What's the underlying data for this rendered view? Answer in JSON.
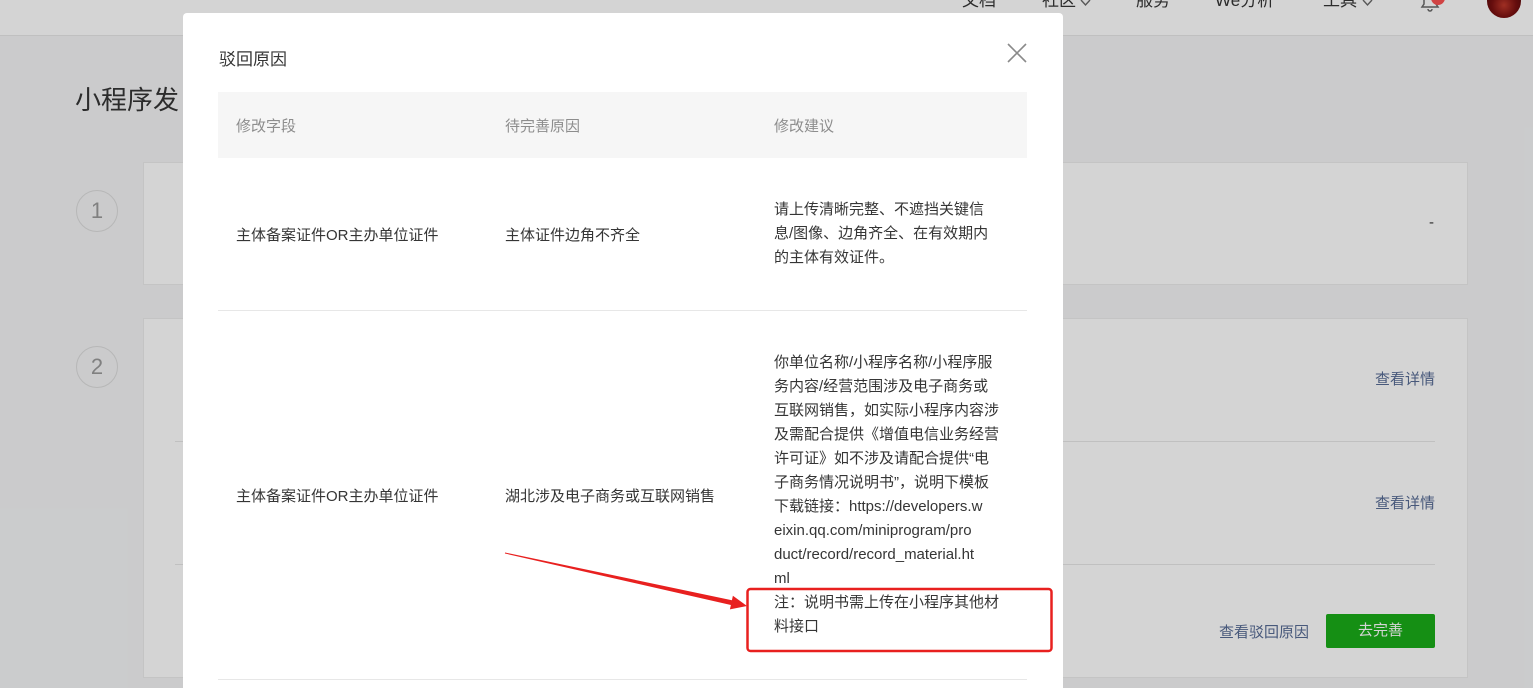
{
  "top_nav": {
    "items": [
      {
        "label": "文档"
      },
      {
        "label": "社区",
        "dropdown_icon": "chevron-down-icon"
      },
      {
        "label": "服务"
      },
      {
        "label": "We分析"
      },
      {
        "label": "工具",
        "dropdown_icon": "chevron-down-icon"
      }
    ],
    "notification_icon": "bell-icon",
    "avatar_icon": "user-avatar"
  },
  "page": {
    "title": "小程序发",
    "steps": [
      {
        "number": "1",
        "status": "-"
      },
      {
        "number": "2",
        "rows": [
          {
            "link_label": "查看详情"
          },
          {
            "link_label": "查看详情"
          },
          {
            "link_label": "查看驳回原因",
            "button_label": "去完善"
          }
        ]
      }
    ]
  },
  "modal": {
    "title": "驳回原因",
    "close_icon": "close-icon",
    "table": {
      "headers": [
        "修改字段",
        "待完善原因",
        "修改建议"
      ],
      "rows": [
        {
          "field": "主体备案证件OR主办单位证件",
          "reason": "主体证件边角不齐全",
          "suggestion_lines": [
            "请上传清晰完整、不遮挡关键信",
            "息/图像、边角齐全、在有效期内",
            "的主体有效证件。"
          ]
        },
        {
          "field": "主体备案证件OR主办单位证件",
          "reason": "湖北涉及电子商务或互联网销售",
          "suggestion_lines": [
            "你单位名称/小程序名称/小程序服",
            "务内容/经营范围涉及电子商务或",
            "互联网销售，如实际小程序内容涉",
            "及需配合提供《增值电信业务经营",
            "许可证》如不涉及请配合提供“电",
            "子商务情况说明书”，说明下模板",
            "下载链接：https://developers.w",
            "eixin.qq.com/miniprogram/pro",
            "duct/record/record_material.ht",
            "ml",
            "注：说明书需上传在小程序其他材",
            "料接口"
          ]
        }
      ]
    }
  },
  "colors": {
    "brand_green": "#1aad19",
    "link": "#576b95",
    "notification_badge": "#fa5151",
    "annotation_red": "#e8201f"
  }
}
